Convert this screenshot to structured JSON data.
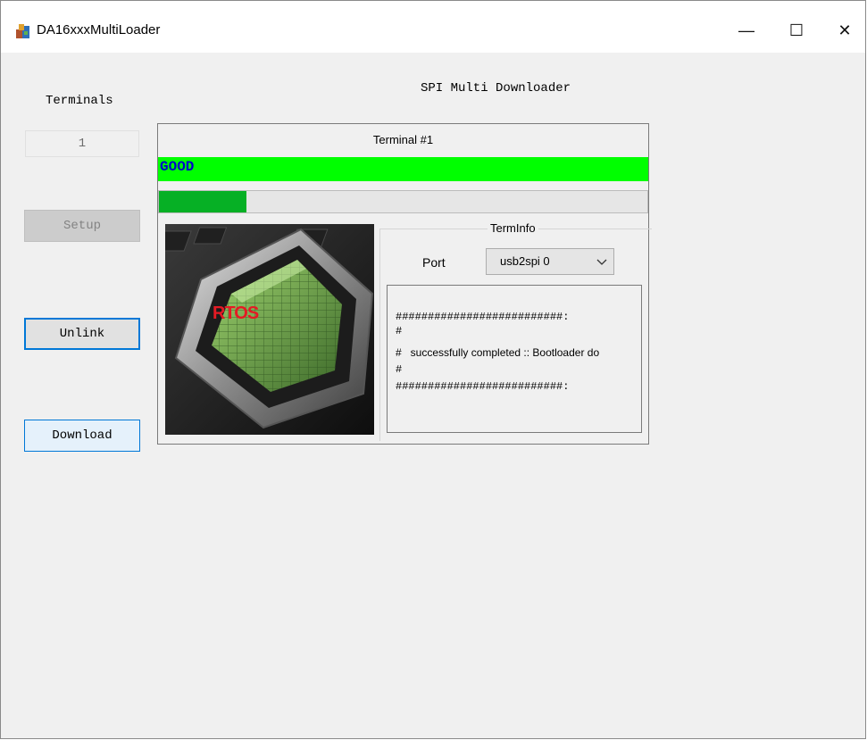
{
  "window": {
    "title": "DA16xxxMultiLoader",
    "minimize_glyph": "—",
    "maximize_glyph": "☐",
    "close_glyph": "✕"
  },
  "sidebar": {
    "terminals_label": "Terminals",
    "terminals_count": "1",
    "setup_label": "Setup",
    "unlink_label": "Unlink",
    "download_label": "Download"
  },
  "main": {
    "title": "SPI Multi Downloader",
    "terminal": {
      "title": "Terminal #1",
      "status": "GOOD",
      "progress": 0.18,
      "image_label": "RTOS",
      "terminfo": {
        "group_label": "TermInfo",
        "port_label": "Port",
        "port_value": "usb2spi 0",
        "log_lines": [
          "##########################:",
          "#",
          "#   successfully completed :: Bootloader do",
          "#",
          "##########################:"
        ]
      }
    }
  },
  "colors": {
    "status_bg": "#00ff00",
    "status_text": "#0000cc",
    "progress_fill": "#06b025",
    "accent_border": "#0078d7",
    "rtos_label": "#e51a24"
  },
  "icons": {
    "app": "app-icon",
    "chevron": "chevron-down-icon"
  }
}
